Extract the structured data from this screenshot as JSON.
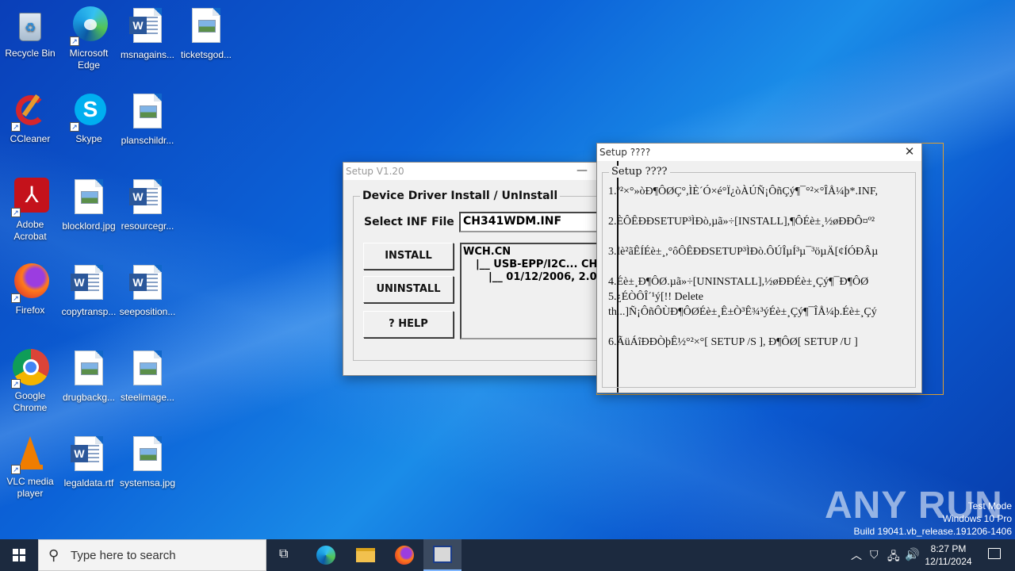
{
  "desktop": {
    "icons": [
      {
        "label": "Recycle Bin",
        "icon": "recycle-bin-icon"
      },
      {
        "label": "Microsoft Edge",
        "icon": "edge-icon"
      },
      {
        "label": "msnagains...",
        "icon": "word-doc-icon"
      },
      {
        "label": "ticketsgod...",
        "icon": "image-file-icon"
      },
      {
        "label": "CCleaner",
        "icon": "ccleaner-icon"
      },
      {
        "label": "Skype",
        "icon": "skype-icon"
      },
      {
        "label": "planschildr...",
        "icon": "image-file-icon"
      },
      {
        "label": "Adobe Acrobat",
        "icon": "acrobat-icon"
      },
      {
        "label": "blocklord.jpg",
        "icon": "image-file-icon"
      },
      {
        "label": "resourcegr...",
        "icon": "word-doc-icon"
      },
      {
        "label": "Firefox",
        "icon": "firefox-icon"
      },
      {
        "label": "copytransp...",
        "icon": "word-doc-icon"
      },
      {
        "label": "seeposition...",
        "icon": "word-doc-icon"
      },
      {
        "label": "Google Chrome",
        "icon": "chrome-icon"
      },
      {
        "label": "drugbackg...",
        "icon": "image-file-icon"
      },
      {
        "label": "steelimage...",
        "icon": "image-file-icon"
      },
      {
        "label": "VLC media player",
        "icon": "vlc-icon"
      },
      {
        "label": "legaldata.rtf",
        "icon": "word-doc-icon"
      },
      {
        "label": "systemsa.jpg",
        "icon": "image-file-icon"
      }
    ]
  },
  "setup_window": {
    "title": "Setup V1.20",
    "minimize": "—",
    "group_title": "Device Driver Install / UnInstall",
    "inf_label": "Select INF File :",
    "inf_value": "CH341WDM.INF",
    "install": "INSTALL",
    "uninstall": "UNINSTALL",
    "help": "? HELP",
    "tree": [
      "WCH.CN",
      "|__ USB-EPP/I2C... CH3",
      "|__ 01/12/2006, 2.0.2"
    ]
  },
  "help_window": {
    "title": "Setup ????",
    "close": "✕",
    "group_title": "Setup ????",
    "lines": [
      "1.º²×°»òÐ¶ÔØÇ°,ÌÈ´Ó×é°Ï¿òÀÚÑ¡ÔñÇý¶¯°²×°ÎÅ¼þ*.INF,",
      "2.ÈÔÊÐÐSETUP³ÌÐò,µã»÷[INSTALL],¶ÔÉè±¸½øÐÐÔ¤º²",
      "3.Ìè²ãÊÍÉè±¸,°ôÔÊÐÐSETUP³ÌÐò.ÔÚÎµÍ³µ¯³öµÄ[¢ÍÓÐÂµ",
      "4.Éè±¸Ð¶ÔØ.µã»÷[UNINSTALL],½øÐÐÉè±¸Çý¶¯Ð¶ÔØ",
      "5.¿ÉÒÔÎ´¹ý[!! Delete",
      "th...]Ñ¡ÔñÔÙÐ¶ÔØÉè±¸Ê±Ò³Ê¾³ýÉè±¸Çý¶¯ÎÅ¼þ.Éè±¸Çý",
      "6.ÃüÁîÐÐÒþÊ½°²×°[ SETUP /S ], Ð¶ÔØ[ SETUP /U ]"
    ]
  },
  "watermark": {
    "brand": "ANY RUN",
    "line1": "Test Mode",
    "line2": "Windows 10 Pro",
    "line3": "Build 19041.vb_release.191206-1406"
  },
  "taskbar": {
    "search_placeholder": "Type here to search",
    "time": "8:27 PM",
    "date": "12/11/2024"
  },
  "colors": {
    "taskbar": "#1c2a3f",
    "accent": "#0c63d8",
    "focus_outline": "#e0a030"
  }
}
